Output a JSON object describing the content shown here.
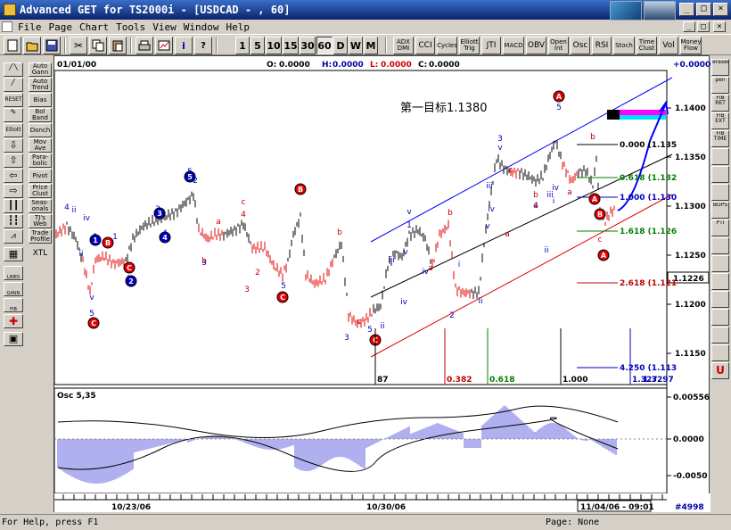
{
  "window": {
    "title": "Advanced GET for TS2000i - [USDCAD - , 60]",
    "controls": {
      "minimize": "_",
      "maximize": "□",
      "close": "×"
    }
  },
  "menu": {
    "items": [
      "File",
      "Page",
      "Chart",
      "Tools",
      "View",
      "Window",
      "Help"
    ],
    "mdi_controls": [
      "_",
      "□",
      "×"
    ]
  },
  "toolbar": {
    "periods": [
      "1",
      "5",
      "10",
      "15",
      "30",
      "60",
      "D",
      "W",
      "M"
    ],
    "active_period": "60",
    "indicators": [
      "ADX DMI",
      "CCI",
      "Cycles",
      "Elliott Trig",
      "JTI",
      "MACD",
      "OBV",
      "Open Int",
      "Osc",
      "RSI",
      "Stoch",
      "Time Clust",
      "Vol",
      "Money Flow"
    ]
  },
  "left_tools": [
    {
      "label": "Auto Gann",
      "icon": "gann-icon"
    },
    {
      "label": "Auto Trend",
      "icon": "trend-icon"
    },
    {
      "label": "Bias",
      "icon": "reset-icon",
      "icon_text": "RESET"
    },
    {
      "label": "Bol Band",
      "icon": "draw-icon"
    },
    {
      "label": "Donch",
      "icon": "elliott-icon",
      "icon_text": "Elliott"
    },
    {
      "label": "Mov Ave",
      "icon": "arrow-down-icon"
    },
    {
      "label": "Para- bolic",
      "icon": "arrow-up-icon"
    },
    {
      "label": "Pivot",
      "icon": "arrow-left-icon"
    },
    {
      "label": "Price Clust",
      "icon": "arrow-right-icon"
    },
    {
      "label": "Seas- onals",
      "icon": "bars-icon"
    },
    {
      "label": "TJ's Web",
      "icon": "candles-icon"
    },
    {
      "label": "Trade Profile",
      "icon": "zigzag-icon"
    },
    {
      "label": "XTL",
      "icon": "grid-icon"
    }
  ],
  "left_extra_tools": [
    "LINES",
    "GANN",
    "FIB"
  ],
  "right_tools": [
    "eraser",
    "pen",
    "FIB RET",
    "FIB EXT",
    "FIB TIME",
    "",
    "",
    "",
    "BOPS",
    "PTI",
    "",
    "",
    "",
    "",
    "",
    "",
    "",
    "U"
  ],
  "chart": {
    "date_label": "01/01/00",
    "ohlc": {
      "o_label": "O:",
      "o": "0.0000",
      "h_label": "H:",
      "h": "0.0000",
      "l_label": "L:",
      "l": "0.0000",
      "c_label": "C:",
      "c": "0.0000"
    },
    "top_right_value": "+0.0000",
    "annotation": "第一目标1.1380",
    "price_axis": [
      "1.1400",
      "1.1350",
      "1.1300",
      "1.1250",
      "1.1226",
      "1.1200",
      "1.1150"
    ],
    "current_price": "1.1226",
    "fib_levels": [
      {
        "label": "0.000 (1.135",
        "color": "#000000"
      },
      {
        "label": "0.618 (1.132",
        "color": "#008000"
      },
      {
        "label": "1.000 (1.130",
        "color": "#0000c0"
      },
      {
        "label": "1.618 (1.126",
        "color": "#008000"
      },
      {
        "label": "2.618 (1.121",
        "color": "#c00000"
      },
      {
        "label": "4.250 (1.113",
        "color": "#0000c0"
      }
    ],
    "time_fibs": [
      {
        "label": "87",
        "color": "#000000"
      },
      {
        "label": "0.382",
        "color": "#c00000"
      },
      {
        "label": "0.618",
        "color": "#008000"
      },
      {
        "label": "1.000",
        "color": "#000000"
      },
      {
        "label": "1.327",
        "color": "#0000c0"
      }
    ],
    "time_fib_extra": "1.3297",
    "wave_labels_blue": [
      "4",
      "ii",
      "iv",
      "1",
      "ii",
      "v",
      "5",
      "2",
      "3",
      "4",
      "5",
      "2",
      "1",
      "3",
      "iii",
      "iv",
      "v",
      "ii",
      "1",
      "v",
      "iv",
      "2",
      "i",
      "ii",
      "iii",
      "iv",
      "v",
      "3",
      "v",
      "4",
      "iii",
      "i",
      "ii",
      "iv",
      "5",
      "3",
      "5",
      "5"
    ],
    "wave_labels_red": [
      "B",
      "C",
      "a",
      "b",
      "c",
      "4",
      "2",
      "3",
      "b",
      "c",
      "a",
      "b",
      "a",
      "c",
      "b",
      "a",
      "b",
      "a",
      "A",
      "B",
      "c",
      "C",
      "C",
      "A",
      "B",
      "C",
      "A",
      "c"
    ],
    "osc": {
      "label": "Osc 5,35",
      "axis": [
        "0.00556",
        "0.0000",
        "-0.0050"
      ]
    },
    "dates": [
      "10/23/06",
      "10/30/06",
      "11/04/06 - 09:01"
    ],
    "record_count": "#4998"
  },
  "status": {
    "help": "For Help, press F1",
    "page": "Page: None"
  },
  "colors": {
    "bull_bar": "#000000",
    "bear_bar": "#e00000",
    "channel_blue": "#0000ff",
    "channel_red": "#e00000",
    "osc_bar": "#6060e0",
    "target_box_1": "#ff00ff",
    "target_box_2": "#00e0ff"
  }
}
